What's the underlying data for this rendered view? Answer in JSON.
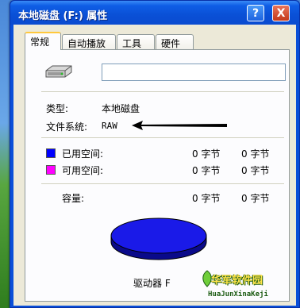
{
  "window": {
    "title": "本地磁盘 (F:) 属性",
    "help_label": "?",
    "close_label": "X"
  },
  "tabs": [
    {
      "label": "常规",
      "active": true
    },
    {
      "label": "自动播放",
      "active": false
    },
    {
      "label": "工具",
      "active": false
    },
    {
      "label": "硬件",
      "active": false
    }
  ],
  "general": {
    "drive_icon": "hard-drive-icon",
    "name_value": "",
    "type_label": "类型:",
    "type_value": "本地磁盘",
    "fs_label": "文件系统:",
    "fs_value": "RAW",
    "used_label": "已用空间:",
    "used_bytes": "0 字节",
    "used_size": "0 字节",
    "free_label": "可用空间:",
    "free_bytes": "0 字节",
    "free_size": "0 字节",
    "capacity_label": "容量:",
    "capacity_bytes": "0 字节",
    "capacity_size": "0 字节",
    "drive_label": "驱动器 F"
  },
  "colors": {
    "used_swatch": "#0000ff",
    "free_swatch": "#ff00ff",
    "pie_top": "#1a1ae8",
    "pie_side": "#0a0a8a"
  },
  "watermark": {
    "text": "华军软件园",
    "subtext": "HuaJunXinaKeji"
  }
}
